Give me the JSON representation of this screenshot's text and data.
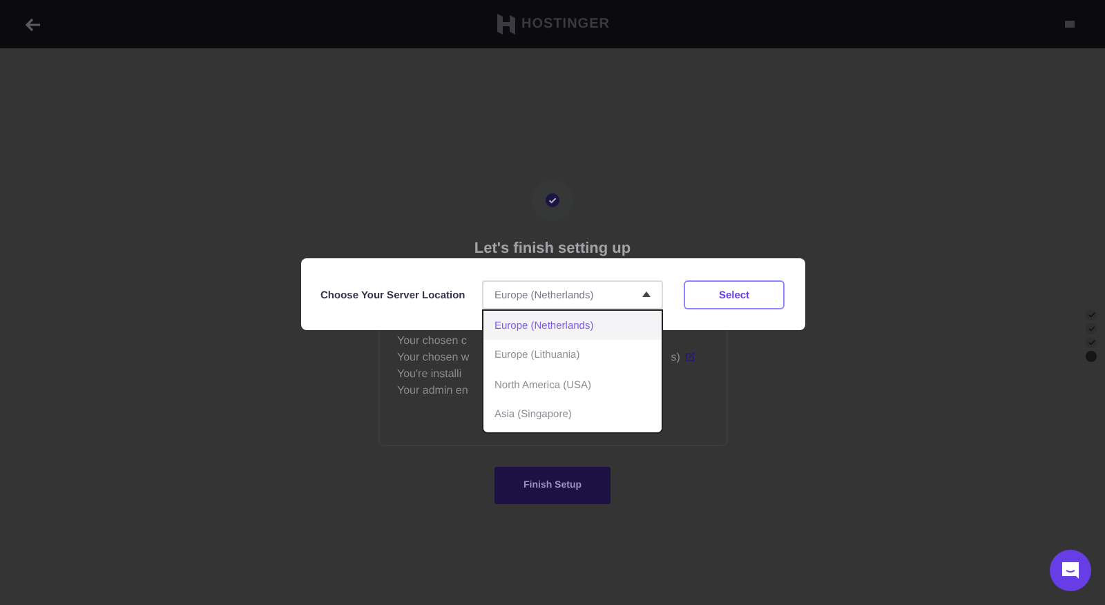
{
  "header": {
    "logo_text": "HOSTINGER"
  },
  "setup": {
    "title": "Let's finish setting up",
    "summary_lines": [
      {
        "kind": "plain",
        "text": "Your chosen c"
      },
      {
        "kind": "editable",
        "text": "Your chosen w",
        "tail": "s)"
      },
      {
        "kind": "plain",
        "text": "You're installi"
      },
      {
        "kind": "plain",
        "text": "Your admin en"
      }
    ],
    "finish_button": "Finish Setup"
  },
  "modal": {
    "label": "Choose Your Server Location",
    "select": {
      "value": "Europe (Netherlands)",
      "expanded": true,
      "options": [
        {
          "label": "Europe (Netherlands)",
          "selected": true
        },
        {
          "label": "Europe (Lithuania)",
          "selected": false
        },
        {
          "label": "North America (USA)",
          "selected": false
        },
        {
          "label": "Asia (Singapore)",
          "selected": false
        }
      ]
    },
    "button": "Select"
  },
  "progress_steps": [
    {
      "completed": true
    },
    {
      "completed": true
    },
    {
      "completed": true
    },
    {
      "completed": false
    }
  ]
}
